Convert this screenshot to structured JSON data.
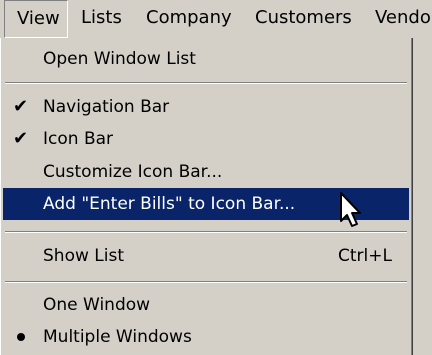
{
  "menubar": {
    "items": [
      "View",
      "Lists",
      "Company",
      "Customers",
      "Vendo"
    ],
    "active_index": 0
  },
  "menu": {
    "open_window_list": "Open Window List",
    "navigation_bar": {
      "label": "Navigation Bar",
      "checked": true
    },
    "icon_bar": {
      "label": "Icon Bar",
      "checked": true
    },
    "customize_icon_bar": "Customize Icon Bar...",
    "add_enter_bills": {
      "label": "Add \"Enter Bills\" to Icon Bar...",
      "highlighted": true
    },
    "show_list": {
      "label": "Show List",
      "shortcut": "Ctrl+L"
    },
    "one_window": "One Window",
    "multiple_windows": {
      "label": "Multiple Windows",
      "selected": true
    }
  },
  "glyphs": {
    "check": "✔"
  },
  "colors": {
    "highlight": "#0a246a",
    "menu_bg": "#d4d0c8"
  }
}
